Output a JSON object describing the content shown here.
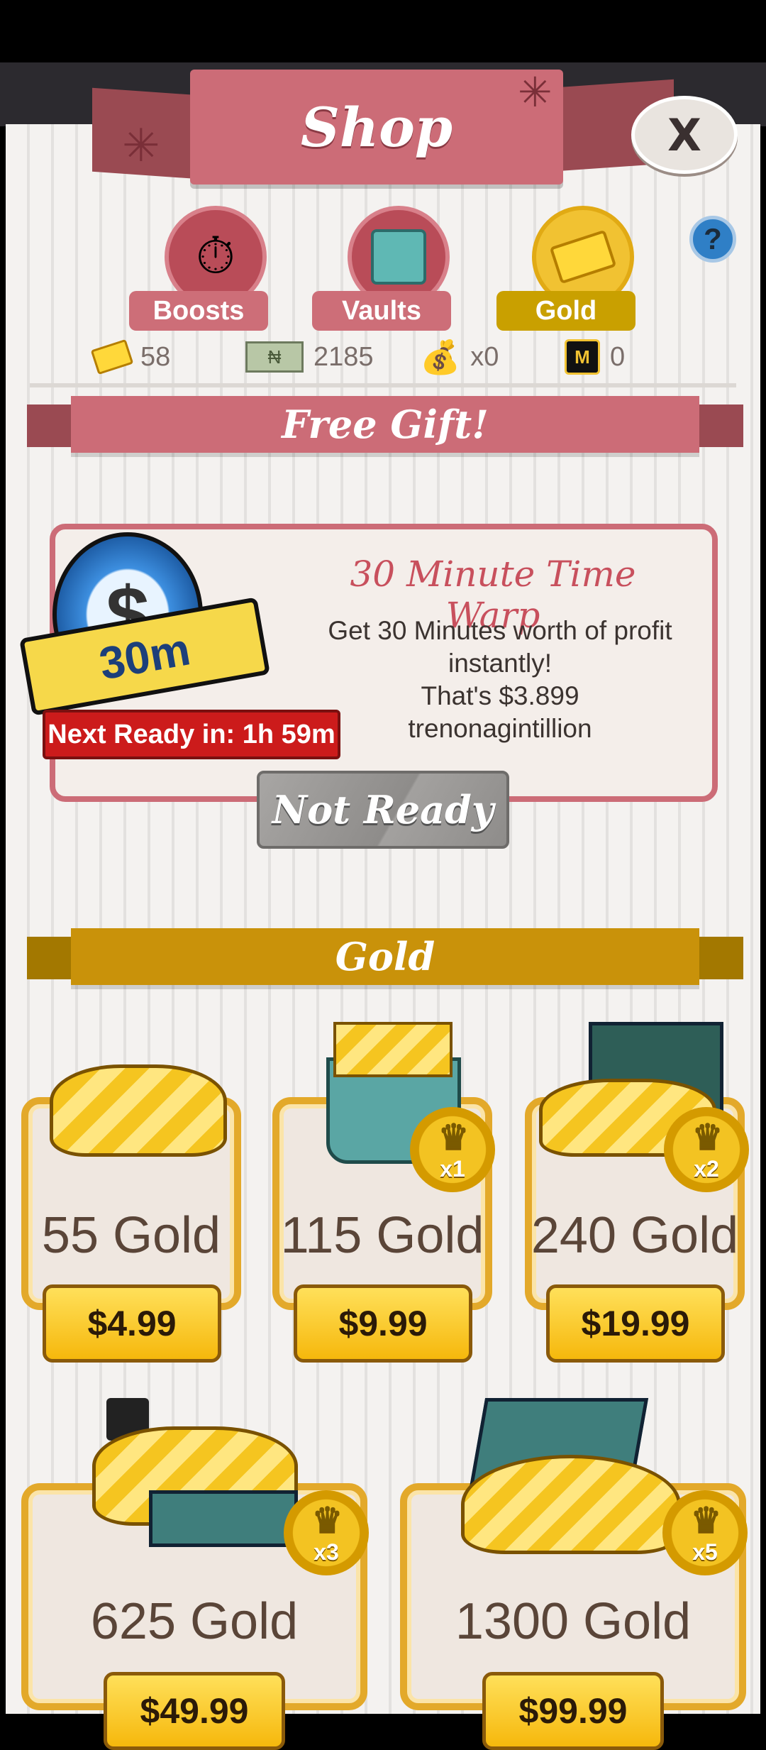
{
  "header": {
    "title": "Shop",
    "close_label": "X",
    "help_label": "?"
  },
  "tabs": [
    {
      "label": "Boosts",
      "active": false
    },
    {
      "label": "Vaults",
      "active": false
    },
    {
      "label": "Gold",
      "active": true
    }
  ],
  "currencies": {
    "gold": "58",
    "cash": "2185",
    "cash_icon": "₦",
    "bags": "x0",
    "tokens": "0"
  },
  "free_gift": {
    "section_title": "Free Gift!",
    "badge": "30m",
    "title": "30 Minute Time Warp",
    "desc_line1": "Get 30 Minutes worth of profit instantly!",
    "desc_line2": "That's $3.899 trenonagintillion",
    "next_ready": "Next Ready in: 1h 59m",
    "button": "Not Ready"
  },
  "gold_section": {
    "title": "Gold",
    "packs": [
      {
        "name": "55 Gold",
        "price": "$4.99",
        "multiplier": ""
      },
      {
        "name": "115 Gold",
        "price": "$9.99",
        "multiplier": "x1"
      },
      {
        "name": "240 Gold",
        "price": "$19.99",
        "multiplier": "x2"
      },
      {
        "name": "625 Gold",
        "price": "$49.99",
        "multiplier": "x3"
      },
      {
        "name": "1300 Gold",
        "price": "$99.99",
        "multiplier": "x5"
      }
    ]
  },
  "colors": {
    "accent_pink": "#cc6c77",
    "gold": "#c9a000",
    "button_gold": "#f6b80c"
  }
}
